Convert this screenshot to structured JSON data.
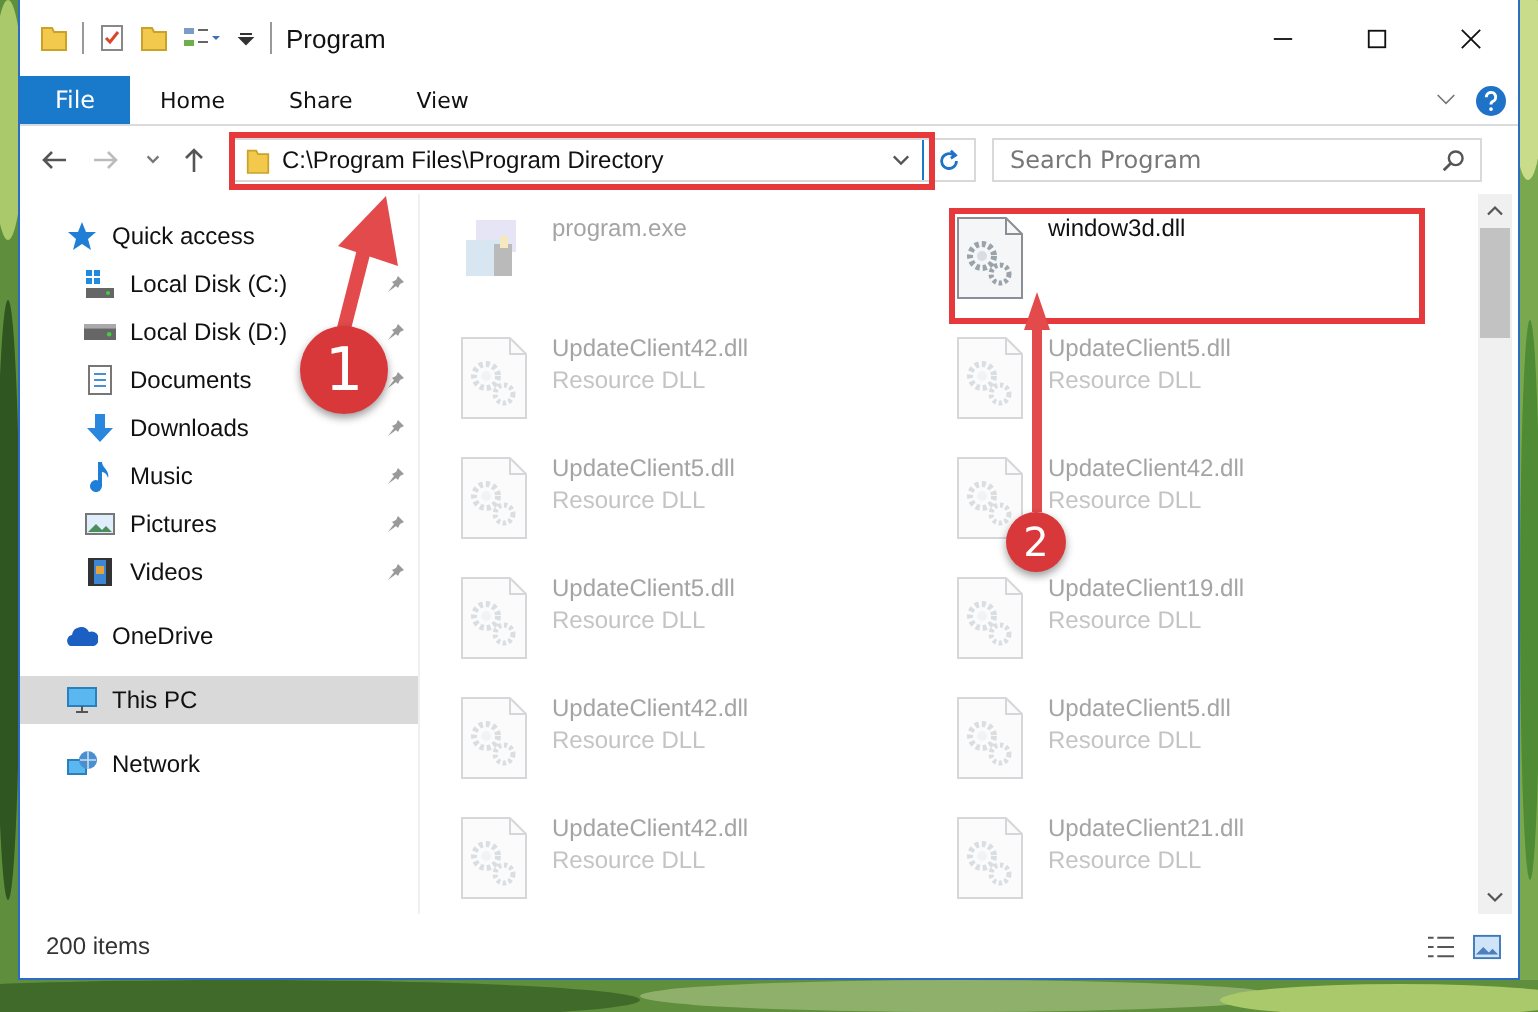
{
  "window": {
    "title": "Program"
  },
  "ribbon": {
    "tabs": [
      {
        "label": "File",
        "kind": "file"
      },
      {
        "label": "Home",
        "kind": "tab"
      },
      {
        "label": "Share",
        "kind": "tab"
      },
      {
        "label": "View",
        "kind": "tab"
      }
    ]
  },
  "address_bar": {
    "path": "C:\\Program Files\\Program Directory"
  },
  "search": {
    "placeholder": "Search Program"
  },
  "sidebar": {
    "items": [
      {
        "label": "Quick access",
        "kind": "star",
        "selected": false,
        "children": [
          {
            "label": "Local Disk (C:)",
            "kind": "system-drive",
            "pinned": true,
            "selected": false
          },
          {
            "label": "Local Disk (D:)",
            "kind": "drive",
            "pinned": true,
            "selected": false
          },
          {
            "label": "Documents",
            "kind": "documents",
            "pinned": true,
            "selected": false
          },
          {
            "label": "Downloads",
            "kind": "downloads",
            "pinned": true,
            "selected": false
          },
          {
            "label": "Music",
            "kind": "music",
            "pinned": true,
            "selected": false
          },
          {
            "label": "Pictures",
            "kind": "pictures",
            "pinned": true,
            "selected": false
          },
          {
            "label": "Videos",
            "kind": "videos",
            "pinned": true,
            "selected": false
          }
        ]
      },
      {
        "label": "OneDrive",
        "kind": "cloud",
        "selected": false
      },
      {
        "label": "This PC",
        "kind": "pc",
        "selected": true
      },
      {
        "label": "Network",
        "kind": "network",
        "selected": false
      }
    ]
  },
  "files": [
    {
      "name": "program.exe",
      "kind": "exe",
      "blurred": true
    },
    {
      "name": "window3d.dll",
      "kind": "dll",
      "blurred": false
    },
    {
      "name": "UpdateClient42.dll",
      "type": "Resource DLL",
      "kind": "dll",
      "blurred": true
    },
    {
      "name": "UpdateClient5.dll",
      "type": "Resource DLL",
      "kind": "dll",
      "blurred": true
    },
    {
      "name": "UpdateClient5.dll",
      "type": "Resource DLL",
      "kind": "dll",
      "blurred": true
    },
    {
      "name": "UpdateClient42.dll",
      "type": "Resource DLL",
      "kind": "dll",
      "blurred": true
    },
    {
      "name": "UpdateClient5.dll",
      "type": "Resource DLL",
      "kind": "dll",
      "blurred": true
    },
    {
      "name": "UpdateClient19.dll",
      "type": "Resource DLL",
      "kind": "dll",
      "blurred": true
    },
    {
      "name": "UpdateClient42.dll",
      "type": "Resource DLL",
      "kind": "dll",
      "blurred": true
    },
    {
      "name": "UpdateClient5.dll",
      "type": "Resource DLL",
      "kind": "dll",
      "blurred": true
    },
    {
      "name": "UpdateClient42.dll",
      "type": "Resource DLL",
      "kind": "dll",
      "blurred": true
    },
    {
      "name": "UpdateClient21.dll",
      "type": "Resource DLL",
      "kind": "dll",
      "blurred": true
    }
  ],
  "status_bar": {
    "item_count": "200 items"
  },
  "annotations": {
    "markers": [
      {
        "number": "1"
      },
      {
        "number": "2"
      }
    ]
  }
}
